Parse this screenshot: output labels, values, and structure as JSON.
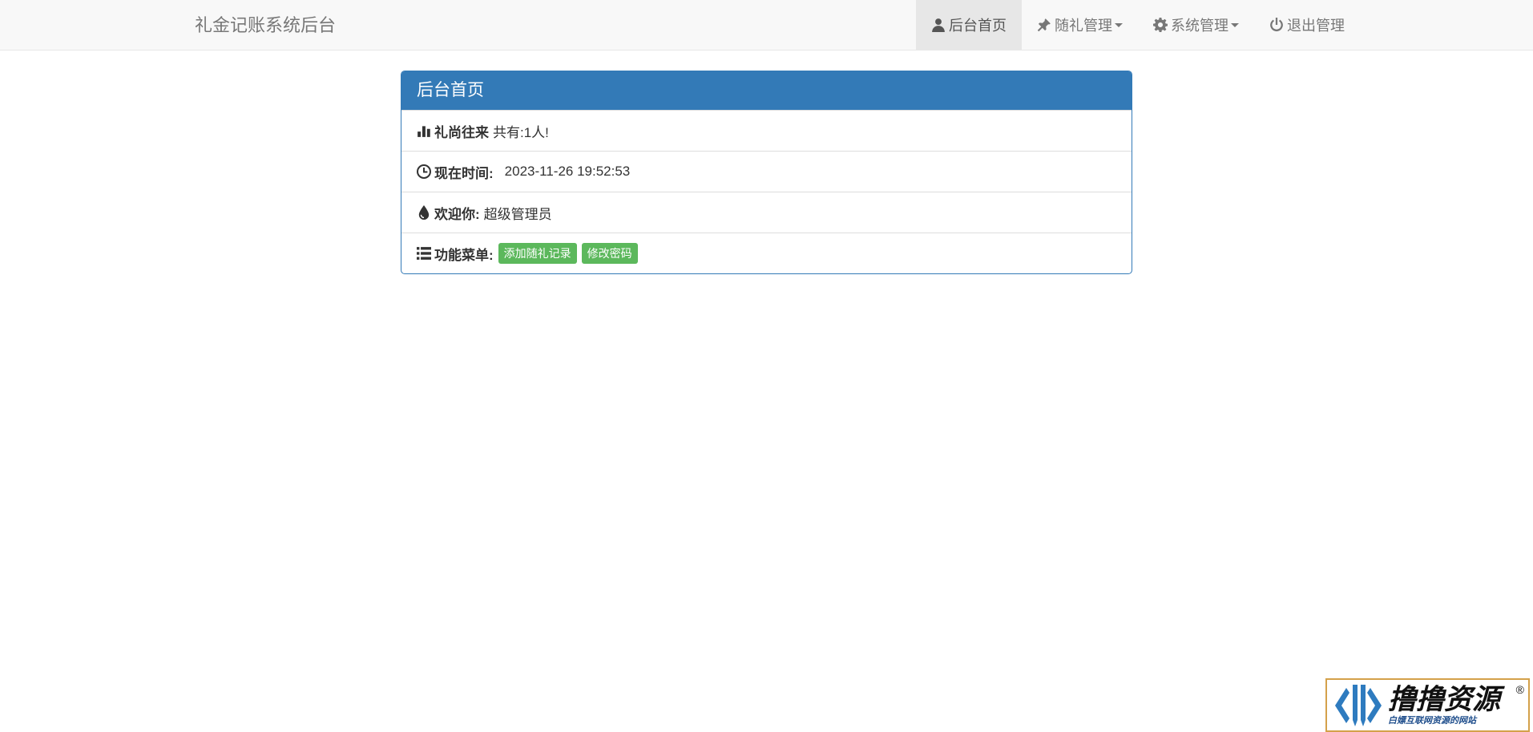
{
  "navbar": {
    "brand": "礼金记账系统后台",
    "items": [
      {
        "label": "后台首页",
        "icon": "user-icon",
        "active": true
      },
      {
        "label": "随礼管理",
        "icon": "pushpin-icon",
        "dropdown": true
      },
      {
        "label": "系统管理",
        "icon": "gear-icon",
        "dropdown": true
      },
      {
        "label": "退出管理",
        "icon": "power-icon"
      }
    ]
  },
  "panel": {
    "title": "后台首页",
    "rows": [
      {
        "icon": "bar-chart-icon",
        "label": "礼尚往来",
        "value": "共有:1人!"
      },
      {
        "icon": "clock-icon",
        "label": "现在时间:",
        "value": "2023-11-26 19:52:53"
      },
      {
        "icon": "drop-icon",
        "label": "欢迎你:",
        "value": "超级管理员"
      },
      {
        "icon": "list-icon",
        "label": "功能菜单:",
        "buttons": [
          "添加随礼记录",
          "修改密码"
        ]
      }
    ]
  },
  "colors": {
    "primary": "#337ab7",
    "success": "#5cb85c",
    "navbar_bg": "#f8f8f8"
  },
  "watermark": {
    "title": "撸撸资源",
    "subtitle": "白嫖互联网资源的网站",
    "mark": "®"
  }
}
